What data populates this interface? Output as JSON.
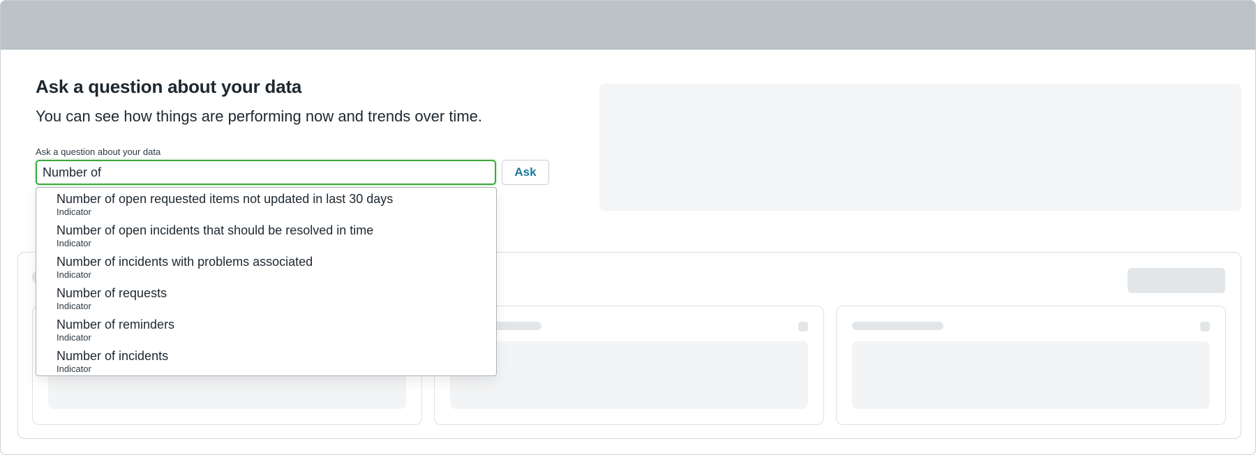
{
  "header": {
    "title": "Ask a question about your data",
    "subtitle": "You can see how things are performing now and trends over time."
  },
  "search": {
    "label": "Ask a question about your data",
    "value": "Number of",
    "ask_label": "Ask"
  },
  "suggestions": [
    {
      "title": "Number of open requested items not updated in last 30 days",
      "type": "Indicator"
    },
    {
      "title": "Number of open incidents that should be resolved in time",
      "type": "Indicator"
    },
    {
      "title": "Number of incidents with problems associated",
      "type": "Indicator"
    },
    {
      "title": "Number of requests",
      "type": "Indicator"
    },
    {
      "title": "Number of reminders",
      "type": "Indicator"
    },
    {
      "title": "Number of incidents",
      "type": "Indicator"
    }
  ],
  "colors": {
    "topbar": "#bbc3c7",
    "focus_border": "#3aa93a",
    "ask_text": "#19799a",
    "skeleton": "#e3e6e8"
  }
}
